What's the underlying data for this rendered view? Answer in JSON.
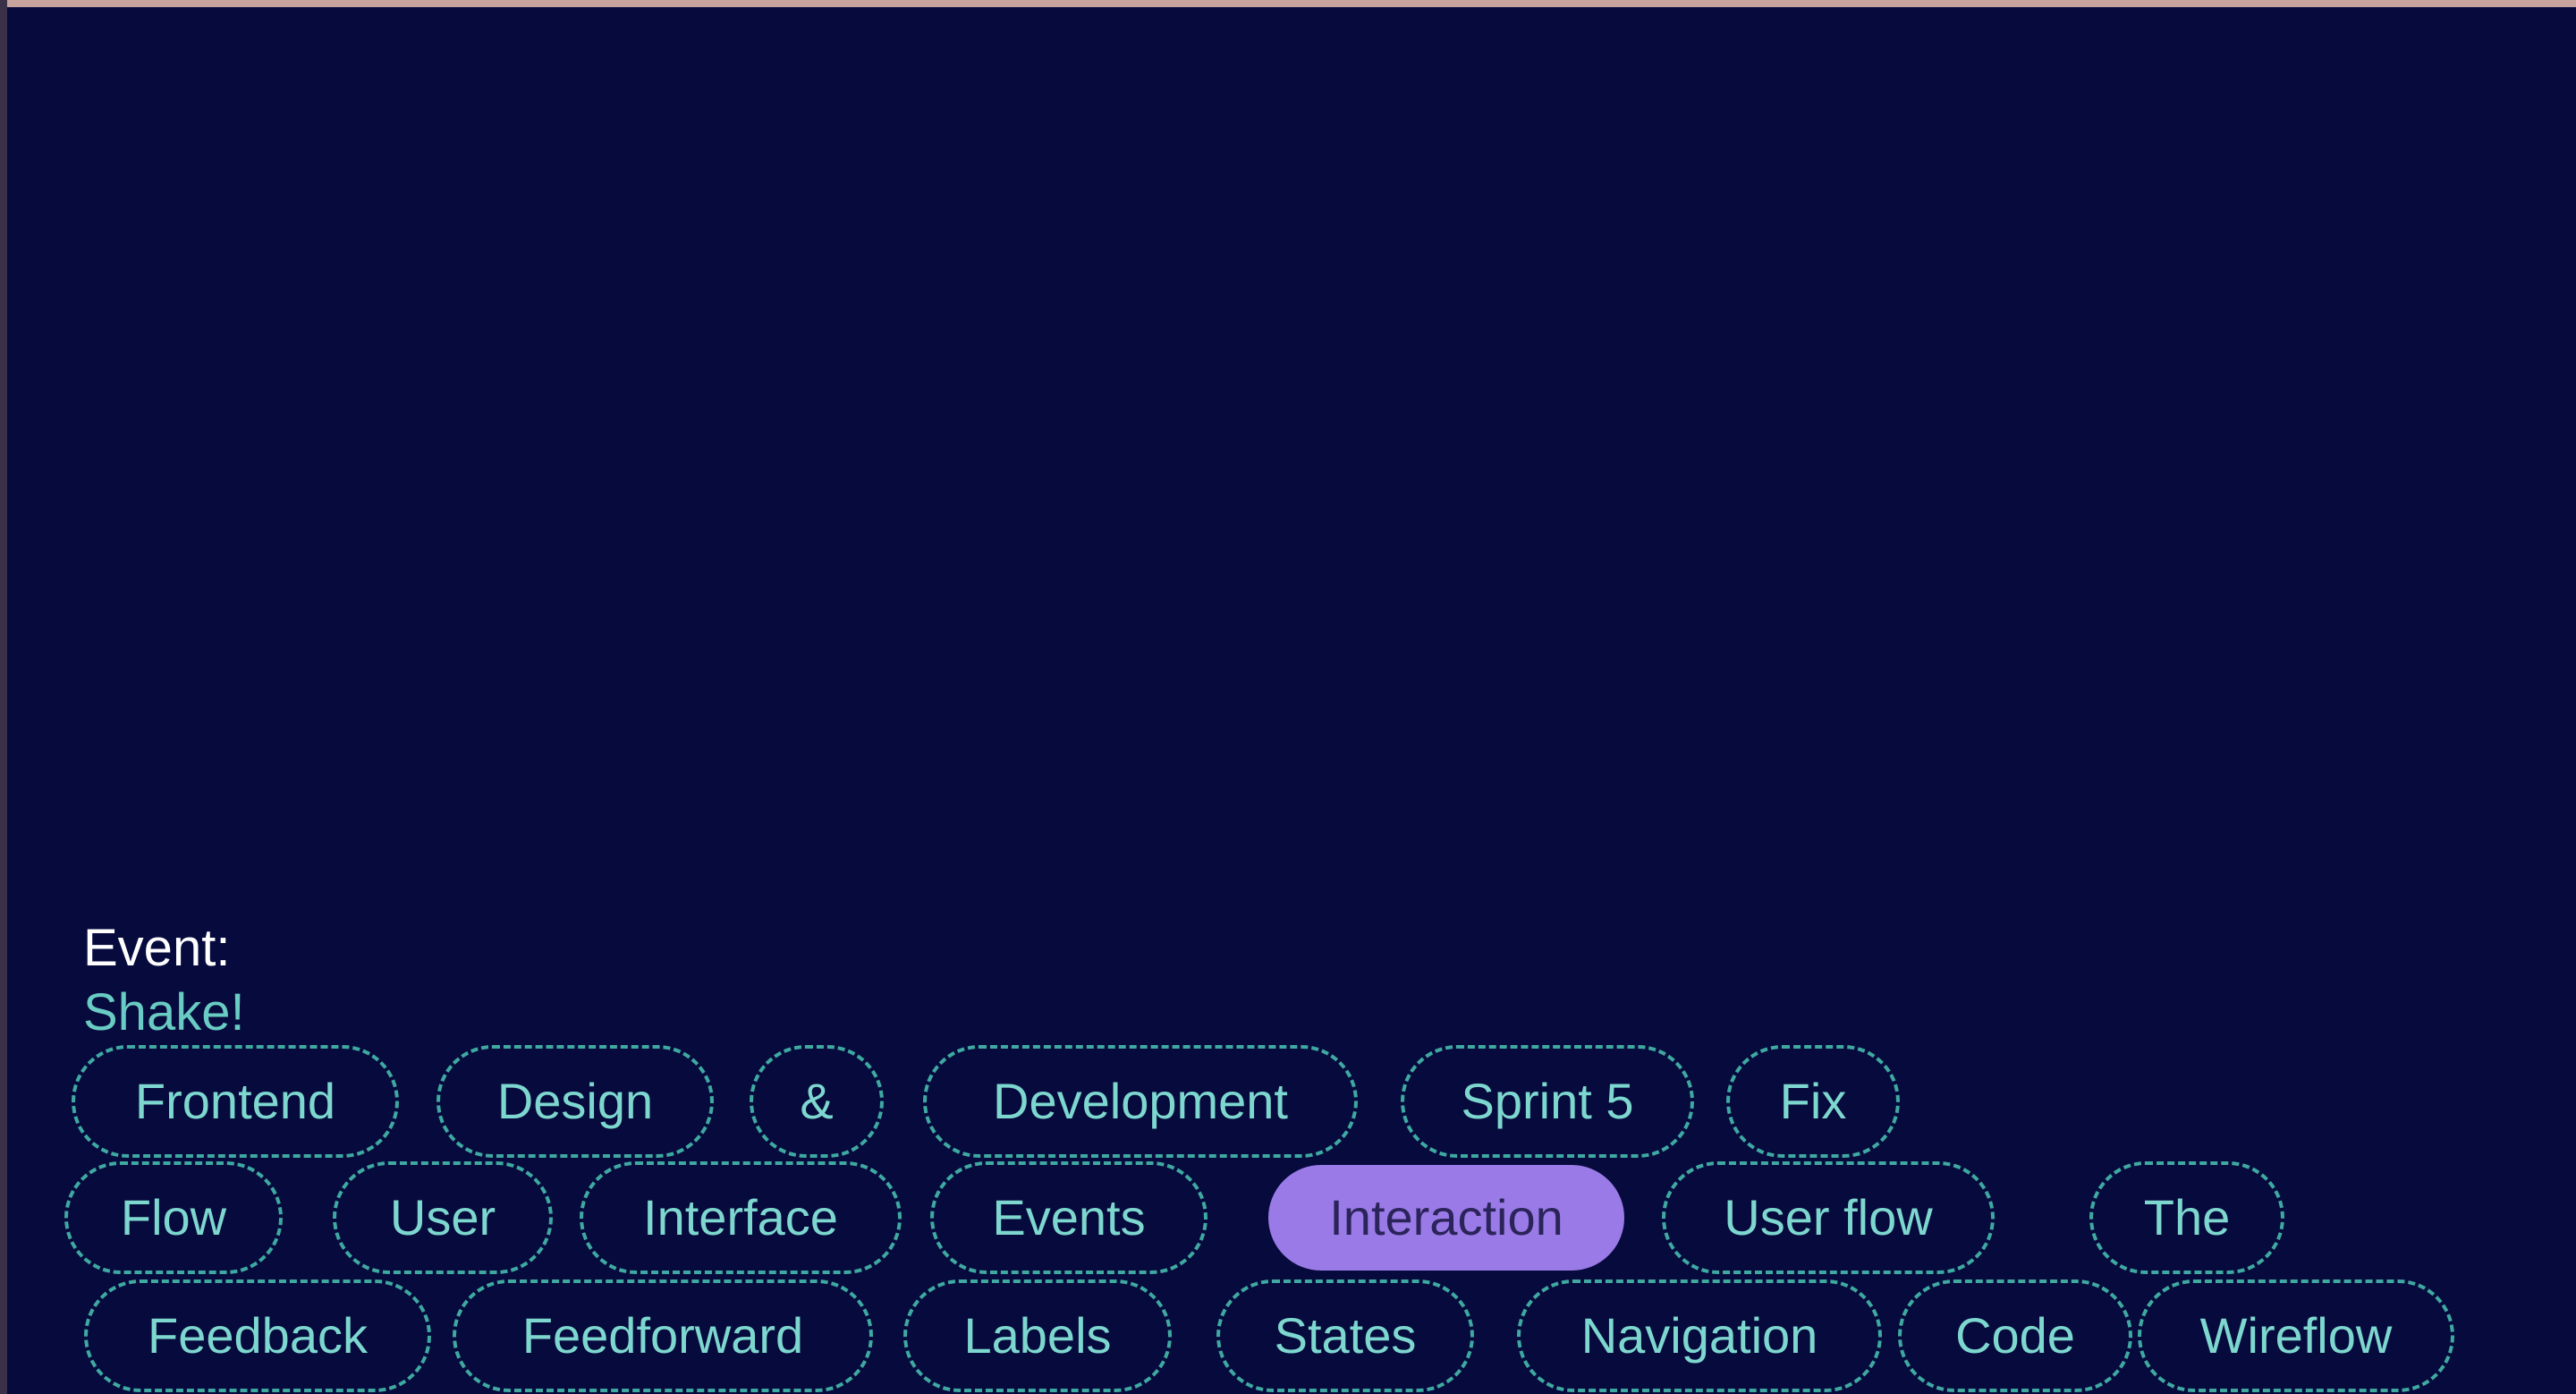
{
  "event": {
    "label": "Event:",
    "value": "Shake!"
  },
  "chips": [
    {
      "id": "frontend",
      "label": "Frontend",
      "active": false
    },
    {
      "id": "design",
      "label": "Design",
      "active": false
    },
    {
      "id": "ampersand",
      "label": "&",
      "active": false
    },
    {
      "id": "development",
      "label": "Development",
      "active": false
    },
    {
      "id": "sprint-5",
      "label": "Sprint 5",
      "active": false
    },
    {
      "id": "fix",
      "label": "Fix",
      "active": false
    },
    {
      "id": "flow",
      "label": "Flow",
      "active": false
    },
    {
      "id": "user",
      "label": "User",
      "active": false
    },
    {
      "id": "interface",
      "label": "Interface",
      "active": false
    },
    {
      "id": "events",
      "label": "Events",
      "active": false
    },
    {
      "id": "interaction",
      "label": "Interaction",
      "active": true
    },
    {
      "id": "user-flow",
      "label": "User flow",
      "active": false
    },
    {
      "id": "the",
      "label": "The",
      "active": false
    },
    {
      "id": "feedback",
      "label": "Feedback",
      "active": false
    },
    {
      "id": "feedforward",
      "label": "Feedforward",
      "active": false
    },
    {
      "id": "labels",
      "label": "Labels",
      "active": false
    },
    {
      "id": "states",
      "label": "States",
      "active": false
    },
    {
      "id": "navigation",
      "label": "Navigation",
      "active": false
    },
    {
      "id": "code",
      "label": "Code",
      "active": false
    },
    {
      "id": "wireflow",
      "label": "Wireflow",
      "active": false
    }
  ],
  "colors": {
    "background": "#060a3d",
    "chip_border": "#3fa9a1",
    "chip_text": "#7dd7cf",
    "active_chip": "#9a7ae6"
  }
}
